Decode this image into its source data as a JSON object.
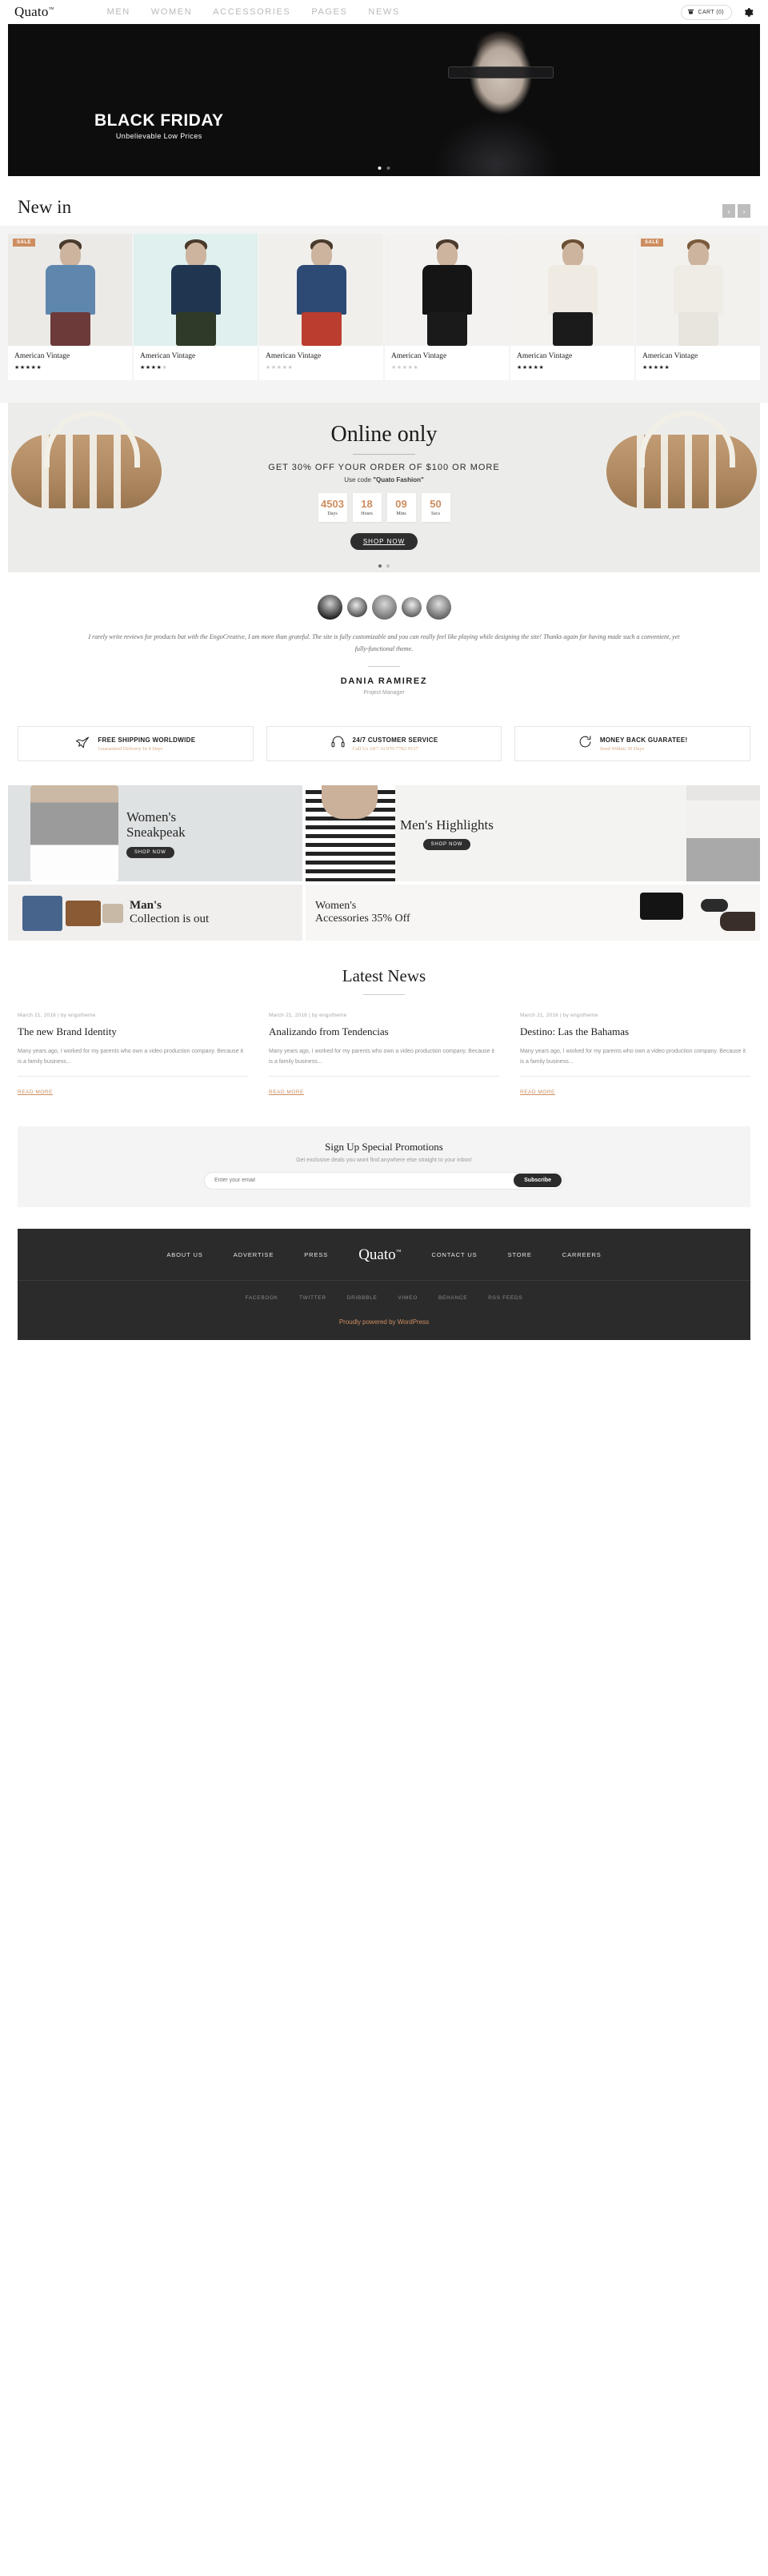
{
  "header": {
    "logo": "Quato",
    "logo_tm": "™",
    "nav": [
      {
        "label": "MEN"
      },
      {
        "label": "WOMEN"
      },
      {
        "label": "ACCESSORIES"
      },
      {
        "label": "PAGES"
      },
      {
        "label": "NEWS"
      }
    ],
    "cart_label": "CART (0)",
    "settings_icon": "gear-icon"
  },
  "hero": {
    "title": "BLACK FRIDAY",
    "subtitle": "Unbelievable Low Prices",
    "dots": 2,
    "active_dot": 0
  },
  "newin": {
    "title": "New in",
    "prev_label": "‹",
    "next_label": "›",
    "products": [
      {
        "name": "American Vintage",
        "sale": "SALE",
        "rating": 5,
        "shirt": "#5f87ad",
        "pants": "#6d3a3a",
        "bg": "#eceae7"
      },
      {
        "name": "American Vintage",
        "sale": "",
        "rating": 4,
        "shirt": "#1f3550",
        "pants": "#2f3a28",
        "bg": "#dff0ee"
      },
      {
        "name": "American Vintage",
        "sale": "",
        "rating": 0,
        "shirt": "#2d4a74",
        "pants": "#bb3d2f",
        "bg": "#f0efec"
      },
      {
        "name": "American Vintage",
        "sale": "",
        "rating": 0,
        "shirt": "#151515",
        "pants": "#1a1a1a",
        "bg": "#f3f2f0"
      },
      {
        "name": "American Vintage",
        "sale": "",
        "rating": 5,
        "shirt": "#efeae2",
        "pants": "#1b1b1b",
        "bg": "#f4f2ef"
      },
      {
        "name": "American Vintage",
        "sale": "SALE",
        "rating": 5,
        "shirt": "#efece6",
        "pants": "#e8e4de",
        "bg": "#f2f1ee"
      }
    ]
  },
  "online": {
    "title": "Online only",
    "line1": "GET 30% OFF YOUR ORDER OF $100 OR MORE",
    "line2_prefix": "Use code ",
    "line2_code": "\"Quato Fashion\"",
    "counter": [
      {
        "value": "4503",
        "label": "Days"
      },
      {
        "value": "18",
        "label": "Hours"
      },
      {
        "value": "09",
        "label": "Mins"
      },
      {
        "value": "50",
        "label": "Secs"
      }
    ],
    "button": "SHOP NOW",
    "accent": "#cd8d5f"
  },
  "testimonial": {
    "quote": "I rarely write reviews for products but with the EngoCreative, I am more than grateful. The site is fully customizable and you can really feel like playing while designing the site! Thanks again for having made such a convenient, yet fully-functional theme.",
    "name": "DANIA RAMIREZ",
    "role": "Project Manager"
  },
  "services": [
    {
      "icon": "airplane-icon",
      "title": "FREE SHIPPING WORLDWIDE",
      "sub": "Guaranteed Delivery In 4 Days"
    },
    {
      "icon": "headphones-icon",
      "title": "24/7 CUSTOMER SERVICE",
      "sub": "Call Us 24/7 At 070-7782-9137"
    },
    {
      "icon": "refresh-icon",
      "title": "MONEY BACK GUARATEE!",
      "sub": "Send Within 30 Days"
    }
  ],
  "categories": {
    "women_sneakpeak": {
      "line1": "Women's",
      "line2": "Sneakpeak",
      "button": "SHOP NOW"
    },
    "mens_highlights": {
      "line1": "Men's Highlights",
      "button": "SHOP NOW"
    },
    "mans_collection": {
      "line1": "Man's",
      "line2": "Collection is out"
    },
    "womens_accessories": {
      "line1": "Women's",
      "line2": "Accessories 35% Off"
    }
  },
  "news": {
    "title": "Latest News",
    "posts": [
      {
        "meta": "March 21, 2016 | by engotheme",
        "title": "The new Brand Identity",
        "excerpt": "Many years ago, I worked for my parents who own a video production company. Because it is a family business...",
        "readmore": "READ MORE"
      },
      {
        "meta": "March 21, 2016 | by engotheme",
        "title": "Analizando from Tendencias",
        "excerpt": "Many years ago, I worked for my parents who own a video production company. Because it is a family business...",
        "readmore": "READ MORE"
      },
      {
        "meta": "March 21, 2016 | by engotheme",
        "title": "Destino: Las the Bahamas",
        "excerpt": "Many years ago, I worked for my parents who own a video production company. Because it is a family business...",
        "readmore": "READ MORE"
      }
    ]
  },
  "newsletter": {
    "title": "Sign Up Special Promotions",
    "subtitle": "Get exclusive deals you wont find anywhere else straight to your inbox!",
    "placeholder": "Enter your email",
    "value": "",
    "button": "Subscribe"
  },
  "footer": {
    "links_left": [
      {
        "label": "ABOUT US"
      },
      {
        "label": "ADVERTISE"
      },
      {
        "label": "PRESS"
      }
    ],
    "logo": "Quato",
    "logo_tm": "™",
    "links_right": [
      {
        "label": "CONTACT US"
      },
      {
        "label": "STORE"
      },
      {
        "label": "CARREERS"
      }
    ],
    "social": [
      {
        "label": "FACEBOOK"
      },
      {
        "label": "TWITTER"
      },
      {
        "label": "DRIBBBLE"
      },
      {
        "label": "VIMEO"
      },
      {
        "label": "BEHANCE"
      },
      {
        "label": "RSS FEEDS"
      }
    ],
    "credit": "Proudly powered by WordPress"
  }
}
